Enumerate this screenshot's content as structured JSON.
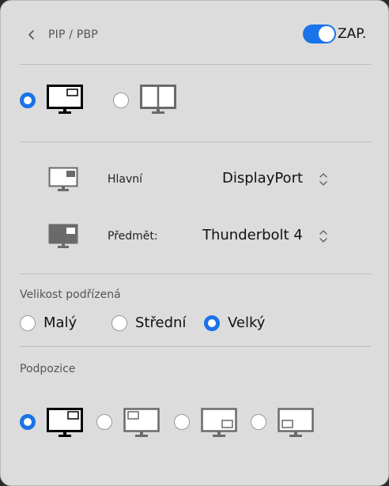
{
  "header": {
    "back_icon": "chevron-left-icon",
    "title": "PIP / PBP",
    "toggle_state": "on",
    "toggle_label": "ZAP.",
    "accent": "#1a73e8"
  },
  "mode": {
    "options": [
      {
        "name": "pip",
        "icon": "monitor-pip-icon",
        "selected": true
      },
      {
        "name": "pbp",
        "icon": "monitor-split-icon",
        "selected": false
      }
    ]
  },
  "sources": {
    "main": {
      "label": "Hlavní",
      "value": "DisplayPort",
      "icon": "monitor-main-icon"
    },
    "sub": {
      "label": "Předmět:",
      "value": "Thunderbolt 4",
      "icon": "monitor-sub-icon"
    }
  },
  "size": {
    "title": "Velikost podřízená",
    "options": [
      {
        "label": "Malý",
        "selected": false
      },
      {
        "label": "Střední",
        "selected": false
      },
      {
        "label": "Velký",
        "selected": true
      }
    ]
  },
  "position": {
    "title": "Podpozice",
    "options": [
      {
        "name": "top-right",
        "selected": true
      },
      {
        "name": "top-left",
        "selected": false
      },
      {
        "name": "bottom-right",
        "selected": false
      },
      {
        "name": "bottom-left",
        "selected": false
      }
    ]
  }
}
